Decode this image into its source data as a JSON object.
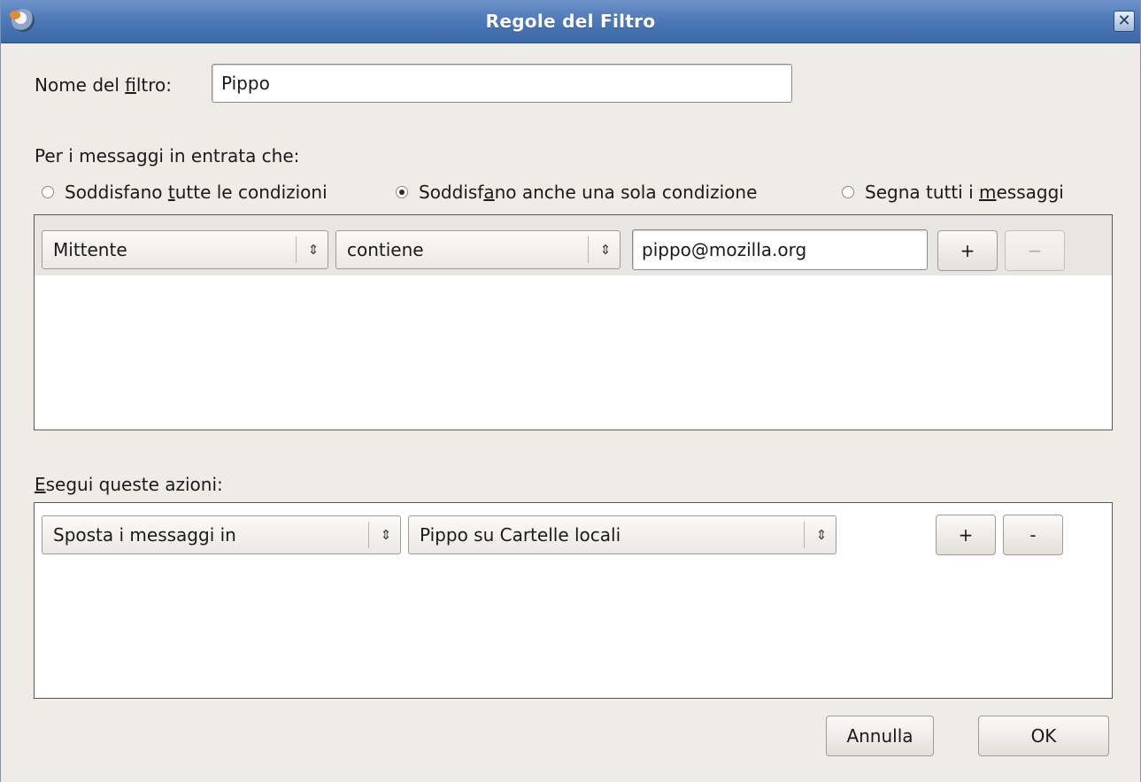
{
  "window": {
    "title": "Regole del Filtro",
    "close_glyph": "✕"
  },
  "filter_name": {
    "label_before": "Nome del ",
    "label_mnemonic": "f",
    "label_after": "iltro:",
    "value": "Pippo"
  },
  "incoming": {
    "heading": "Per i messaggi in entrata che:",
    "options": [
      {
        "before": "Soddisfano ",
        "mnemonic": "t",
        "after": "utte le condizioni",
        "checked": false
      },
      {
        "before": "Soddisf",
        "mnemonic": "a",
        "after": "no anche una sola condizione",
        "checked": true
      },
      {
        "before": "Segna tutti i ",
        "mnemonic": "m",
        "after": "essaggi",
        "checked": false
      }
    ]
  },
  "condition": {
    "field": "Mittente",
    "operator": "contiene",
    "value": "pippo@mozilla.org",
    "add_label": "+",
    "remove_label": "−"
  },
  "actions": {
    "heading_mnemonic": "E",
    "heading_rest": "segui queste azioni:",
    "action": "Sposta i messaggi in",
    "target": "Pippo su Cartelle locali",
    "add_label": "+",
    "remove_label": "-"
  },
  "footer": {
    "cancel_label": "Annulla",
    "ok_label": "OK"
  },
  "icons": {
    "select_arrows": "⇕",
    "app_icon": "thunderbird-icon"
  }
}
